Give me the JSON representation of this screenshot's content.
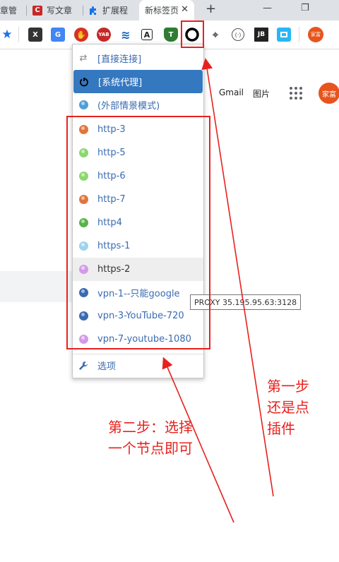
{
  "tabs": [
    {
      "label": "章管",
      "favicon": "generic"
    },
    {
      "label": "写文章",
      "favicon": "csdn-icon"
    },
    {
      "label": "扩展程",
      "favicon": "puzzle-icon"
    },
    {
      "label": "新标签页",
      "favicon": "none",
      "active": true
    }
  ],
  "new_tab_symbol": "+",
  "window_controls": {
    "minimize": "—",
    "restore": "❐"
  },
  "toolbar": {
    "extensions": [
      {
        "name": "bookmark-star-icon",
        "glyph": "★",
        "color": "#1a73e8"
      },
      {
        "name": "x-extension-icon",
        "glyph": "X",
        "color": "#333333"
      },
      {
        "name": "google-translate-icon",
        "glyph": "G",
        "color": "#4285f4"
      },
      {
        "name": "adblock-hand-icon",
        "glyph": "✋",
        "color": "#d93025"
      },
      {
        "name": "yab-icon",
        "glyph": "YAB",
        "color": "#c62828"
      },
      {
        "name": "layers-icon",
        "glyph": "≋",
        "color": "#1565c0"
      },
      {
        "name": "font-a-icon",
        "glyph": "A",
        "color": "#222222"
      },
      {
        "name": "shield-t-icon",
        "glyph": "T",
        "color": "#2e7d32"
      },
      {
        "name": "proxy-switch-icon",
        "glyph": "●",
        "color": "#000000"
      },
      {
        "name": "satellite-icon",
        "glyph": "⌖",
        "color": "#555555"
      },
      {
        "name": "code-brackets-icon",
        "glyph": "(·)",
        "color": "#555555"
      },
      {
        "name": "jb-icon",
        "glyph": "JB",
        "color": "#222222"
      },
      {
        "name": "screenshot-icon",
        "glyph": "▣",
        "color": "#29b6f6"
      }
    ],
    "profile_label": "家富"
  },
  "google": {
    "gmail": "Gmail",
    "images": "图片",
    "avatar_label": "家富"
  },
  "menu": {
    "items": [
      {
        "label": "[直接连接]",
        "icon": "swap-arrows-icon",
        "state": "normal"
      },
      {
        "label": "[系统代理]",
        "icon": "power-icon",
        "state": "selected"
      },
      {
        "label": "(外部情景模式)",
        "icon": "globe-icon",
        "color": "#4f9fd8",
        "state": "normal"
      }
    ],
    "proxies": [
      {
        "label": "http-3",
        "color": "#e0763c"
      },
      {
        "label": "http-5",
        "color": "#8bd86f"
      },
      {
        "label": "http-6",
        "color": "#8bd86f"
      },
      {
        "label": "http-7",
        "color": "#e0763c"
      },
      {
        "label": "http4",
        "color": "#59b34a"
      },
      {
        "label": "https-1",
        "color": "#9fd2ef"
      },
      {
        "label": "https-2",
        "color": "#d49ae8",
        "state": "hover"
      },
      {
        "label": "vpn-1--只能google",
        "color": "#3a6bb0"
      },
      {
        "label": "vpn-3-YouTube-720",
        "color": "#3a6bb0"
      },
      {
        "label": "vpn-7-youtube-1080",
        "color": "#d49ae8"
      }
    ],
    "options_label": "选项"
  },
  "tooltip": "PROXY 35.195.95.63:3128",
  "annotations": {
    "step1": [
      "第一步",
      "还是点",
      "插件"
    ],
    "step2": [
      "第二步：选择",
      "一个节点即可"
    ]
  },
  "colors": {
    "annotation": "#e8211e",
    "selected": "#3478c0",
    "link": "#3a6bb0"
  }
}
